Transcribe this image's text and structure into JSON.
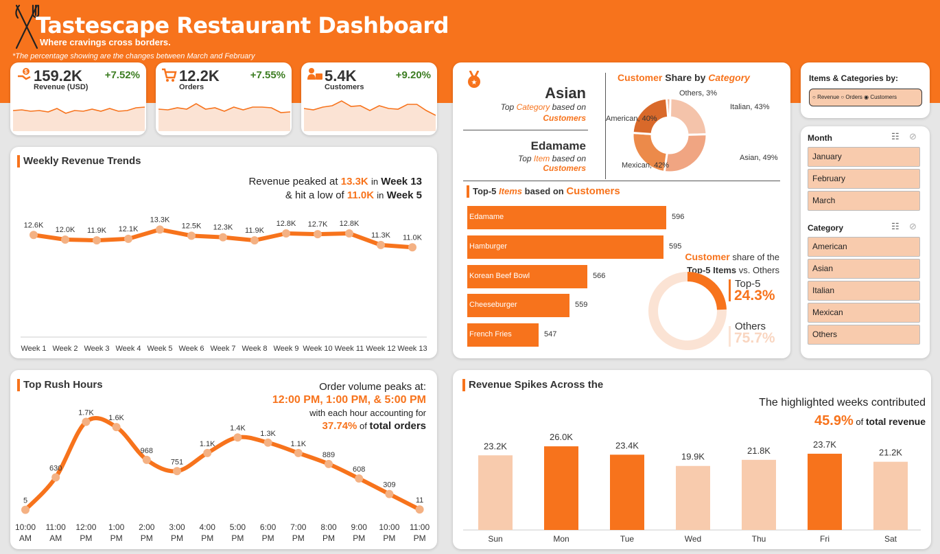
{
  "header": {
    "title": "Tastescape Restaurant Dashboard",
    "subtitle": "Where cravings cross borders.",
    "note": "*The percentage showing are the changes between March and February"
  },
  "kpis": [
    {
      "value": "159.2K",
      "label": "Revenue (USD)",
      "change": "+7.52%",
      "spark": [
        62,
        61,
        63,
        62,
        64,
        59,
        66,
        62,
        63,
        60,
        63,
        59,
        63,
        62,
        58,
        57
      ],
      "icon": "revenue-icon"
    },
    {
      "value": "12.2K",
      "label": "Orders",
      "change": "+7.55%",
      "spark": [
        60,
        61,
        58,
        60,
        52,
        60,
        58,
        63,
        57,
        61,
        57,
        57,
        58,
        65,
        64
      ],
      "icon": "cart-icon"
    },
    {
      "value": "5.4K",
      "label": "Customers",
      "change": "+9.20%",
      "spark": [
        59,
        61,
        57,
        55,
        48,
        56,
        55,
        62,
        55,
        59,
        60,
        53,
        53,
        62,
        69
      ],
      "icon": "customers-icon"
    }
  ],
  "weekly": {
    "title": "Weekly Revenue Trends",
    "insight_line1_pre": "Revenue peaked at",
    "insight_peak": "13.3K",
    "insight_line1_mid": "in",
    "insight_peak_week": "Week 13",
    "insight_line2_pre": "& hit a low of",
    "insight_low": "11.0K",
    "insight_line2_mid": "in",
    "insight_low_week": "Week 5"
  },
  "rush": {
    "title": "Top Rush Hours",
    "insight_line1": "Order volume peaks at:",
    "insight_hours": "12:00 PM, 1:00 PM, & 5:00 PM",
    "insight_line3": "with each hour accounting  for",
    "insight_pct": "37.74%",
    "insight_of": "of",
    "insight_total": "total orders"
  },
  "category_panel": {
    "top_category": "Asian",
    "top_category_pre": "Top",
    "top_category_word": "Category",
    "top_category_post": "based on",
    "top_category_metric": "Customers",
    "top_item": "Edamame",
    "top_item_pre": "Top",
    "top_item_word": "Item",
    "top_item_post": "based on",
    "top_item_metric": "Customers",
    "share_title_a": "Customer",
    "share_title_b": "Share by",
    "share_title_c": "Category",
    "top5_title_a": "Top-5",
    "top5_title_b": "Items",
    "top5_title_c": "based on",
    "top5_title_d": "Customers",
    "share5_a": "Customer",
    "share5_b": "share of the",
    "share5_c": "Top-5 Items",
    "share5_d": "vs. Others",
    "top5_label": "Top-5",
    "top5_pct": "24.3%",
    "others_label": "Others",
    "others_pct": "75.7%"
  },
  "pie_labels": {
    "others": "Others, 3%",
    "italian": "Italian, 43%",
    "american": "American, 40%",
    "asian": "Asian, 49%",
    "mexican": "Mexican, 42%"
  },
  "spikes": {
    "title": "Revenue Spikes Across the",
    "insight_line1": "The highlighted weeks contributed",
    "insight_pct": "45.9%",
    "insight_of": "of",
    "insight_total": "total revenue"
  },
  "filters": {
    "title": "Items & Categories by:",
    "options": [
      "Revenue",
      "Orders",
      "Customers"
    ],
    "selected": "Customers",
    "month_title": "Month",
    "months": [
      "January",
      "February",
      "March"
    ],
    "category_title": "Category",
    "categories": [
      "American",
      "Asian",
      "Italian",
      "Mexican",
      "Others"
    ]
  },
  "colors": {
    "accent": "#f7731c",
    "light": "#f8cbad",
    "positive": "#3c7d22"
  },
  "chart_data": [
    {
      "type": "line",
      "title": "Weekly Revenue Trends",
      "x": [
        "Week 1",
        "Week 2",
        "Week 3",
        "Week 4",
        "Week 5",
        "Week 6",
        "Week 7",
        "Week 8",
        "Week 9",
        "Week 10",
        "Week 11",
        "Week 12",
        "Week 13"
      ],
      "values": [
        12.6,
        12.0,
        11.9,
        12.1,
        13.3,
        12.5,
        12.3,
        11.9,
        12.8,
        12.7,
        12.8,
        11.3,
        11.0
      ],
      "labels": [
        "12.6K",
        "12.0K",
        "11.9K",
        "12.1K",
        "13.3K",
        "12.5K",
        "12.3K",
        "11.9K",
        "12.8K",
        "12.7K",
        "12.8K",
        "11.3K",
        "11.0K"
      ],
      "ylim": [
        0,
        16
      ]
    },
    {
      "type": "line",
      "title": "Top Rush Hours",
      "x": [
        "10:00 AM",
        "11:00 AM",
        "12:00 PM",
        "1:00 PM",
        "2:00 PM",
        "3:00 PM",
        "4:00 PM",
        "5:00 PM",
        "6:00 PM",
        "7:00 PM",
        "8:00 PM",
        "9:00 PM",
        "10:00 PM",
        "11:00 PM"
      ],
      "values": [
        5,
        630,
        1700,
        1600,
        968,
        751,
        1100,
        1400,
        1300,
        1100,
        889,
        608,
        309,
        11
      ],
      "labels": [
        "5",
        "630",
        "1.7K",
        "1.6K",
        "968",
        "751",
        "1.1K",
        "1.4K",
        "1.3K",
        "1.1K",
        "889",
        "608",
        "309",
        "11"
      ],
      "ylim": [
        0,
        1800
      ]
    },
    {
      "type": "pie",
      "title": "Customer Share by Category",
      "categories": [
        "Italian",
        "Asian",
        "Mexican",
        "American",
        "Others"
      ],
      "values": [
        43,
        49,
        42,
        40,
        3
      ],
      "colors": [
        "#f4c3aa",
        "#f0a582",
        "#ec8a4a",
        "#d9692a",
        "#f2b596"
      ]
    },
    {
      "type": "bar",
      "title": "Top-5 Items based on Customers",
      "categories": [
        "Edamame",
        "Hamburger",
        "Korean Beef Bowl",
        "Cheeseburger",
        "French Fries"
      ],
      "values": [
        596,
        595,
        566,
        559,
        547
      ],
      "xlim": [
        0,
        620
      ]
    },
    {
      "type": "pie",
      "title": "Customer share of the Top-5 Items vs. Others",
      "categories": [
        "Top-5",
        "Others"
      ],
      "values": [
        24.3,
        75.7
      ],
      "colors": [
        "#f7731c",
        "#fbe3d4"
      ]
    },
    {
      "type": "bar",
      "title": "Revenue Spikes Across the",
      "categories": [
        "Sun",
        "Mon",
        "Tue",
        "Wed",
        "Thu",
        "Fri",
        "Sat"
      ],
      "values": [
        23.2,
        26.0,
        23.4,
        19.9,
        21.8,
        23.7,
        21.2
      ],
      "labels": [
        "23.2K",
        "26.0K",
        "23.4K",
        "19.9K",
        "21.8K",
        "23.7K",
        "21.2K"
      ],
      "highlighted": [
        false,
        true,
        true,
        false,
        false,
        true,
        false
      ],
      "ylim": [
        0,
        30
      ]
    }
  ]
}
